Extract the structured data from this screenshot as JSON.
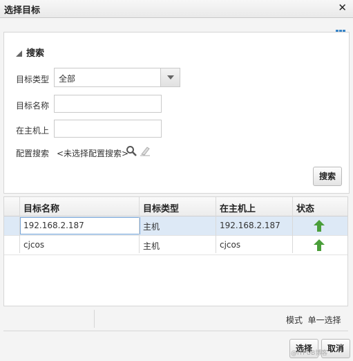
{
  "dialog": {
    "title": "选择目标",
    "close": "✕"
  },
  "search": {
    "header": "搜索",
    "target_type_label": "目标类型",
    "target_type_value": "全部",
    "target_name_label": "目标名称",
    "target_name_value": "",
    "on_host_label": "在主机上",
    "on_host_value": "",
    "saved_search_label": "配置搜索",
    "saved_search_value": "<未选择配置搜索>",
    "search_button": "搜索"
  },
  "table": {
    "columns": [
      "目标名称",
      "目标类型",
      "在主机上",
      "状态"
    ],
    "rows": [
      {
        "name": "192.168.2.187",
        "type": "主机",
        "host": "192.168.2.187",
        "status": "up-arrow-icon"
      },
      {
        "name": "cjcos",
        "type": "主机",
        "host": "cjcos",
        "status": "up-arrow-icon"
      }
    ]
  },
  "footer": {
    "mode_label": "模式",
    "mode_value": "单一选择",
    "select_button": "选择",
    "cancel_button": "取消",
    "watermark": "@ITPUB博客"
  },
  "colors": {
    "selected_row": "#dde9f6",
    "status_up": "#4a9e3a",
    "link_blue": "#3a86c8"
  }
}
